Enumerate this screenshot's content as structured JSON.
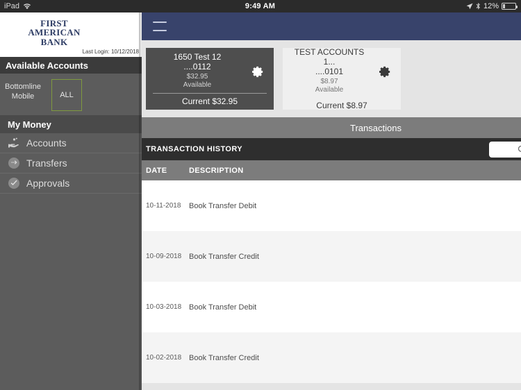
{
  "statusbar": {
    "device": "iPad",
    "wifi_icon": "wifi-icon",
    "time": "9:49 AM",
    "location_icon": "location-arrow-icon",
    "bluetooth_icon": "bluetooth-icon",
    "battery_percent": "12%",
    "battery_icon": "battery-icon"
  },
  "sidebar": {
    "logo": {
      "line1": "FIRST",
      "line2": "AMERICAN",
      "line3": "BANK"
    },
    "last_login": "Last Login:  10/12/2018",
    "available_accounts_header": "Available Accounts",
    "org_label": "Bottomline Mobile",
    "all_button": "ALL",
    "all_button_border": "#7f9a3f",
    "section_title": "My Money",
    "items": [
      {
        "label": "Accounts",
        "icon": "hand-coins-icon"
      },
      {
        "label": "Transfers",
        "icon": "transfer-arrows-icon"
      },
      {
        "label": "Approvals",
        "icon": "check-circle-icon"
      }
    ]
  },
  "app": {
    "navbar": {
      "menu_icon": "hamburger-menu-icon",
      "color": "#38436b"
    },
    "accounts": [
      {
        "name": "1650 Test 12",
        "number": "....0112",
        "available_amount": "$32.95",
        "available_label": "Available",
        "current": "Current $32.95",
        "gear_icon": "gear-icon",
        "selected": true
      },
      {
        "name": "TEST ACCOUNTS 1...",
        "number": "....0101",
        "available_amount": "$8.97",
        "available_label": "Available",
        "current": "Current $8.97",
        "gear_icon": "gear-icon",
        "selected": false
      }
    ],
    "tab": "Transactions",
    "history": {
      "title": "TRANSACTION HISTORY",
      "search_icon": "search-icon",
      "search_value": "",
      "search_placeholder": ""
    },
    "columns": {
      "date": "DATE",
      "description": "DESCRIPTION"
    },
    "transactions": [
      {
        "date": "10-11-2018",
        "description": "Book Transfer Debit"
      },
      {
        "date": "10-09-2018",
        "description": "Book Transfer Credit"
      },
      {
        "date": "10-03-2018",
        "description": "Book Transfer Debit"
      },
      {
        "date": "10-02-2018",
        "description": "Book Transfer Credit"
      }
    ]
  }
}
